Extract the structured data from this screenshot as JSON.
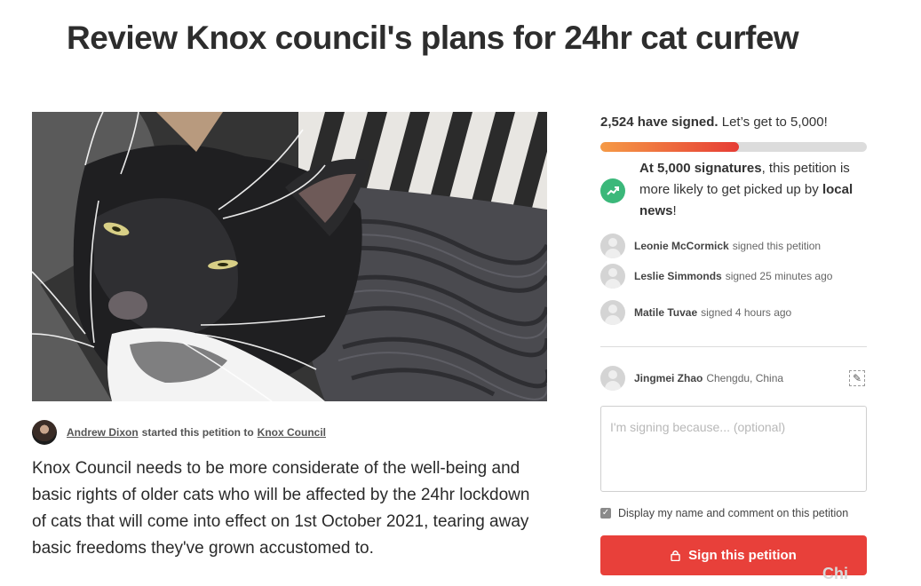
{
  "petition": {
    "title": "Review Knox council's plans for 24hr cat curfew",
    "starter": {
      "name": "Andrew Dixon",
      "middle_text": "started this petition to",
      "target": "Knox Council"
    },
    "description": "Knox Council needs to be more considerate of the well-being and basic rights of older cats who will be affected by the 24hr lockdown of cats that will come into effect on 1st October 2021, tearing away basic freedoms they've grown accustomed to."
  },
  "sidebar": {
    "signed_count": "2,524 have signed.",
    "goal_text": "Let’s get to 5,000!",
    "progress_fraction": 0.52,
    "milestone": {
      "strong_1": "At 5,000 signatures",
      "text_1": ", this petition is more likely to get picked up by ",
      "strong_2": "local news",
      "text_2": "!"
    },
    "recent_signers": [
      {
        "name": "Leonie McCormick",
        "action": "signed this petition"
      },
      {
        "name": "Leslie Simmonds",
        "action": "signed 25 minutes ago"
      },
      {
        "name": "Matile Tuvae",
        "action": "signed 4 hours ago"
      }
    ],
    "current_user": {
      "name": "Jingmei Zhao",
      "location": "Chengdu, China"
    },
    "comment_placeholder": "I'm signing because... (optional)",
    "display_option_label": "Display my name and comment on this petition",
    "sign_button_label": "Sign this petition"
  },
  "watermark": "Chi",
  "colors": {
    "accent_red": "#e8403a",
    "progress_start": "#f59a46",
    "milestone_green": "#3bb87a"
  },
  "icons": [
    "trending-up-icon",
    "edit-icon",
    "lock-icon",
    "checkbox-checked-icon"
  ]
}
